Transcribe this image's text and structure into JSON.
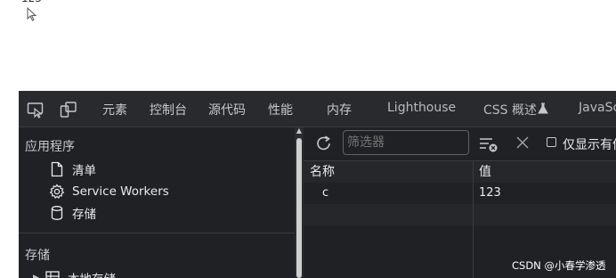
{
  "page": {
    "value_text": "123"
  },
  "tabs": [
    "元素",
    "控制台",
    "源代码",
    "性能",
    "内存",
    "Lighthouse",
    "CSS 概述",
    "JavaScr"
  ],
  "sidebar": {
    "app_header": "应用程序",
    "items": [
      {
        "label": "清单",
        "icon": "document-icon"
      },
      {
        "label": "Service Workers",
        "icon": "gear-icon"
      },
      {
        "label": "存储",
        "icon": "database-icon"
      }
    ],
    "storage_header": "存储",
    "local_storage_label": "本地存储"
  },
  "toolbar": {
    "filter_placeholder": "筛选器",
    "checkbox_label": "仅显示有值"
  },
  "table": {
    "headers": [
      "名称",
      "值"
    ],
    "rows": [
      {
        "key": "c",
        "value": "123"
      }
    ]
  },
  "watermark": "CSDN @小春学渗透",
  "colors": {
    "panel_bg": "#202124",
    "tabbar_bg": "#292a2d",
    "border": "#3c3c3c",
    "text": "#e8eaed"
  }
}
